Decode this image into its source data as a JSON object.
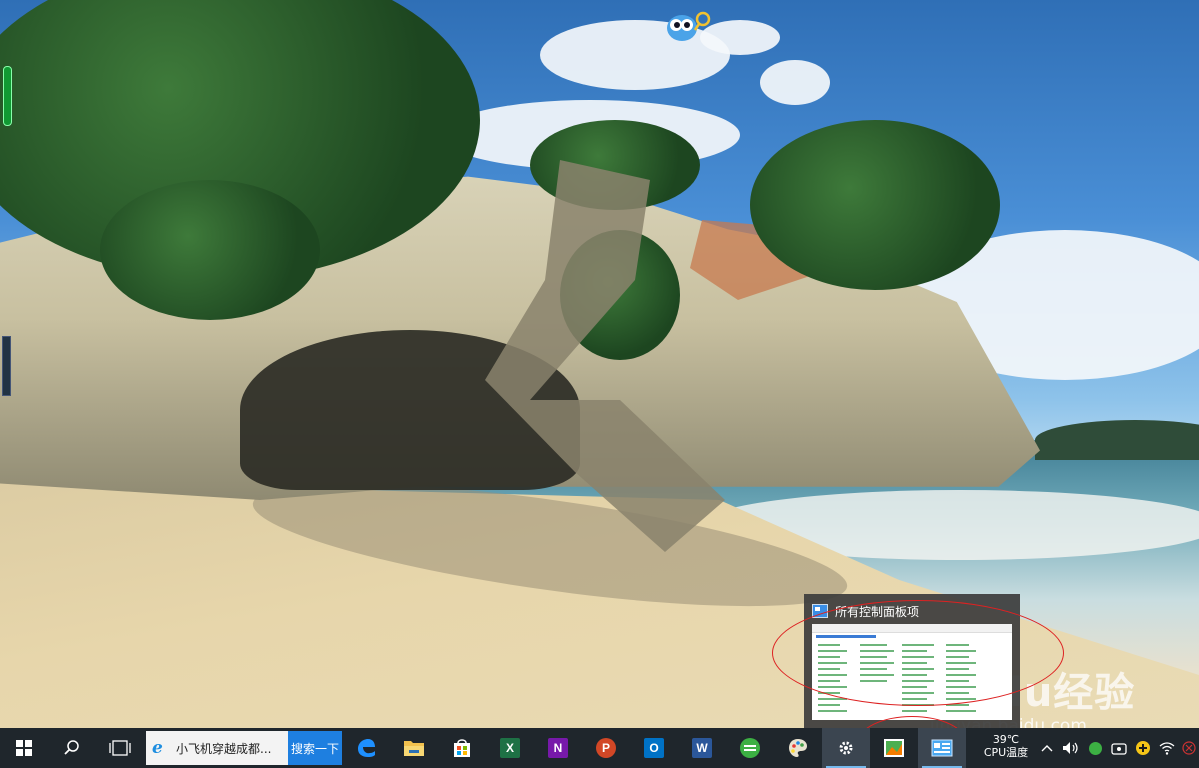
{
  "watermark": {
    "brand": "Baidu经验",
    "url": "jingyan.baidu.com"
  },
  "thumbnail_popup": {
    "title": "所有控制面板项"
  },
  "taskbar": {
    "search": {
      "query": "小飞机穿越成都...",
      "button_label": "搜索一下"
    },
    "pinned_apps": [
      {
        "name": "edge",
        "icon": "edge-icon"
      },
      {
        "name": "file-explorer",
        "icon": "folder-icon"
      },
      {
        "name": "store",
        "icon": "store-icon"
      },
      {
        "name": "excel",
        "icon": "excel-icon",
        "letter": "X",
        "color": "#1e7145"
      },
      {
        "name": "onenote",
        "icon": "onenote-icon",
        "letter": "N",
        "color": "#7719aa"
      },
      {
        "name": "powerpoint",
        "icon": "powerpoint-icon",
        "letter": "P",
        "color": "#d24726"
      },
      {
        "name": "outlook",
        "icon": "outlook-icon",
        "letter": "O",
        "color": "#0072c6"
      },
      {
        "name": "word",
        "icon": "word-icon",
        "letter": "W",
        "color": "#2b579a"
      },
      {
        "name": "browser",
        "icon": "green-browser-icon"
      },
      {
        "name": "paint",
        "icon": "palette-icon"
      },
      {
        "name": "settings",
        "icon": "gear-icon"
      },
      {
        "name": "image-viewer",
        "icon": "photo-icon"
      },
      {
        "name": "control-panel",
        "icon": "control-panel-icon"
      }
    ],
    "cpu_temp": {
      "value": "39℃",
      "label": "CPU温度"
    }
  },
  "colors": {
    "taskbar_bg": "#1f262c",
    "accent": "#1e7fe0",
    "annotation": "#dd2222"
  }
}
